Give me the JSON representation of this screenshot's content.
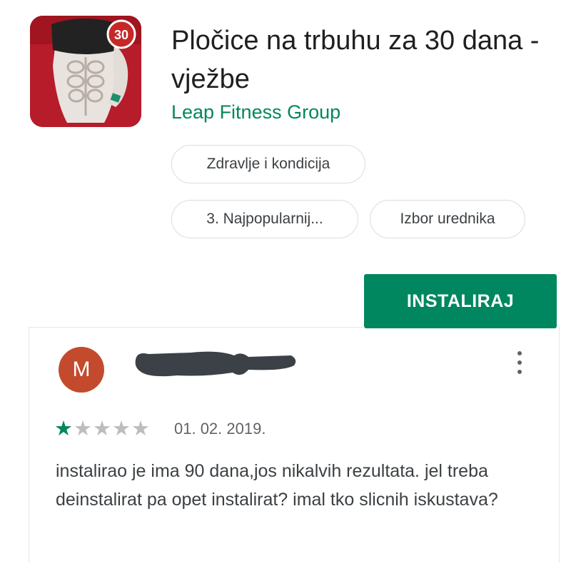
{
  "app": {
    "title": "Pločice na trbuhu za 30 dana - vježbe",
    "developer": "Leap Fitness Group",
    "icon_badge": "30",
    "icon": "abs-fitness-app-icon"
  },
  "chips": {
    "category": "Zdravlje i kondicija",
    "rank": "3. Najpopularnij...",
    "editor": "Izbor urednika"
  },
  "install": {
    "label": "INSTALIRAJ"
  },
  "review": {
    "avatar_letter": "M",
    "rating": 1,
    "rating_max": 5,
    "date": "01. 02. 2019.",
    "text": "instalirao je ima 90 dana,jos nikalvih rezultata. jel treba deinstalirat pa opet instalirat? imal tko slicnih iskustava?"
  },
  "colors": {
    "accent": "#01875f",
    "avatar": "#c34a2c",
    "icon_background": "#b71c2b"
  }
}
